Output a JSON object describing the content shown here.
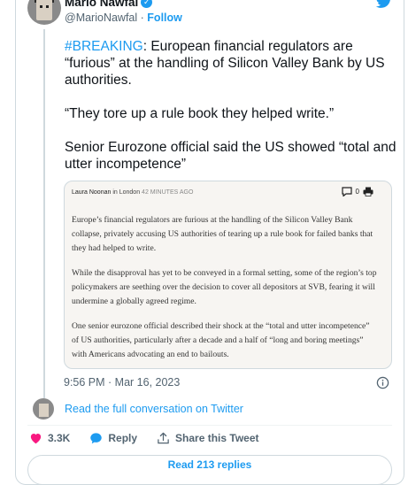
{
  "author": {
    "name": "Mario Nawfal",
    "handle": "@MarioNawfal",
    "separator": "·",
    "follow_label": "Follow"
  },
  "tweet": {
    "hashtag": "#BREAKING",
    "line1_rest": ": European financial regulators are “furious” at the handling of Silicon Valley Bank by US authorities.",
    "paragraph2": "“They tore up a rule book they helped write.”",
    "paragraph3": "Senior Eurozone official said the US showed “total and utter incompetence”"
  },
  "quote_image": {
    "author": "Laura Noonan",
    "location_prefix": "in",
    "location": "London",
    "time_ago": "42 MINUTES AGO",
    "comment_count": "0",
    "paragraphs": [
      "Europe’s financial regulators are furious at the handling of the Silicon Valley Bank collapse, privately accusing US authorities of tearing up a rule book for failed banks that they had helped to write.",
      "While the disapproval has yet to be conveyed in a formal setting, some of the region’s top policymakers are seething over the decision to cover all depositors at SVB, fearing it will undermine a globally agreed regime.",
      "One senior eurozone official described their shock at the “total and utter incompetence” of US authorities, particularly after a decade and a half of “long and boring meetings” with Americans advocating an end to bailouts."
    ]
  },
  "timestamp": "9:56 PM · Mar 16, 2023",
  "read_conversation": "Read the full conversation on Twitter",
  "actions": {
    "likes": "3.3K",
    "reply_label": "Reply",
    "share_label": "Share this Tweet"
  },
  "read_replies": "Read 213 replies",
  "colors": {
    "accent": "#1d9bf0",
    "like": "#f91880",
    "secondary_text": "#536471"
  },
  "icons": [
    "verified-badge-icon",
    "twitter-bird-icon",
    "comment-icon",
    "print-icon",
    "info-icon",
    "heart-icon",
    "reply-bubble-icon",
    "share-icon"
  ]
}
